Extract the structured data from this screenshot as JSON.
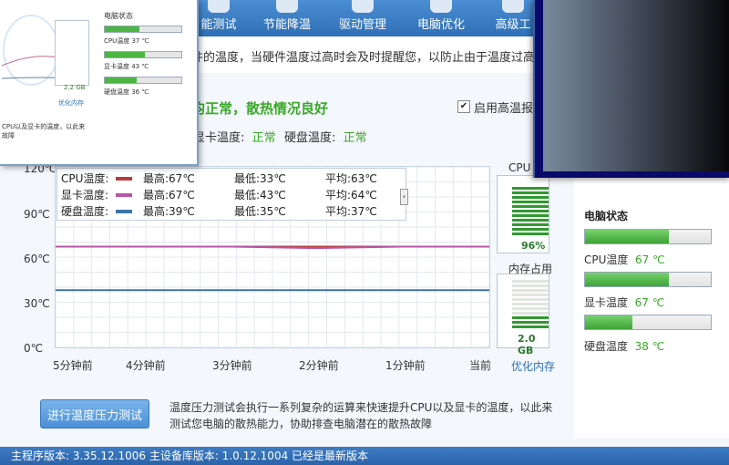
{
  "nav": {
    "tabs": [
      {
        "label": "能测试"
      },
      {
        "label": "节能降温"
      },
      {
        "label": "驱动管理"
      },
      {
        "label": "电脑优化"
      },
      {
        "label": "高级工"
      }
    ]
  },
  "info": {
    "text": "件的温度，当硬件温度过高时会及时提醒您，以防止由于温度过高造成"
  },
  "status": {
    "main": "均正常，散热情况良好",
    "alarm_label": "启用高温报警",
    "alarm_checked": "✔",
    "gpu_label": "显卡温度:",
    "gpu_value": "正常",
    "disk_label": "硬盘温度:",
    "disk_value": "正常"
  },
  "legend": {
    "rows": [
      {
        "name": "CPU温度:",
        "max": "最高:67℃",
        "min": "最低:33℃",
        "avg": "平均:63℃",
        "color": "#b83d3d"
      },
      {
        "name": "显卡温度:",
        "max": "最高:67℃",
        "min": "最低:43℃",
        "avg": "平均:64℃",
        "color": "#b656a7"
      },
      {
        "name": "硬盘温度:",
        "max": "最高:39℃",
        "min": "最低:35℃",
        "avg": "平均:37℃",
        "color": "#3a74a6"
      }
    ],
    "collapse_glyph": "‹"
  },
  "chart_data": {
    "type": "line",
    "x": [
      "5分钟前",
      "4分钟前",
      "3分钟前",
      "2分钟前",
      "1分钟前",
      "当前"
    ],
    "y_ticks": [
      "120℃",
      "90℃",
      "60℃",
      "30℃",
      "0℃"
    ],
    "ylim": [
      0,
      120
    ],
    "grid": true,
    "series": [
      {
        "name": "CPU温度",
        "color": "#b83d3d",
        "values": [
          67,
          67,
          67,
          67,
          67,
          67
        ]
      },
      {
        "name": "显卡温度",
        "color": "#b656a7",
        "values": [
          67,
          67,
          67,
          66,
          67,
          67
        ]
      },
      {
        "name": "硬盘温度",
        "color": "#3a74a6",
        "values": [
          38,
          38,
          38,
          38,
          38,
          38
        ]
      }
    ]
  },
  "gauges": {
    "cpu": {
      "title": "CPU",
      "value": "96%",
      "fill": 0.96
    },
    "mem": {
      "title": "内存占用",
      "value": "2.0 GB",
      "fill": 0.25
    },
    "optimize_link": "优化内存"
  },
  "panel": {
    "title": "电脑状态",
    "items": [
      {
        "label": "CPU温度",
        "value": "67 ℃",
        "fill": 0.67
      },
      {
        "label": "显卡温度",
        "value": "67 ℃",
        "fill": 0.67
      },
      {
        "label": "硬盘温度",
        "value": "38 ℃",
        "fill": 0.38
      }
    ]
  },
  "bottom": {
    "button": "进行温度压力测试",
    "description": "温度压力测试会执行一系列复杂的运算来快速提升CPU以及显卡的温度，以此来测试您电脑的散热能力，协助排查电脑潜在的散热故障"
  },
  "statusbar": {
    "text": "主程序版本: 3.35.12.1006   主设备库版本: 1.0.12.1004   已经是最新版本"
  },
  "mini": {
    "title": "电脑状态",
    "items": [
      {
        "label": "CPU温度  37 ℃"
      },
      {
        "label": "显卡温度  43 ℃"
      },
      {
        "label": "硬盘温度  36 ℃"
      }
    ],
    "mem_value": "2.2 GB",
    "mem_link": "优化内存",
    "desc": "CPU以及显卡的温度，以此来\n故障"
  }
}
